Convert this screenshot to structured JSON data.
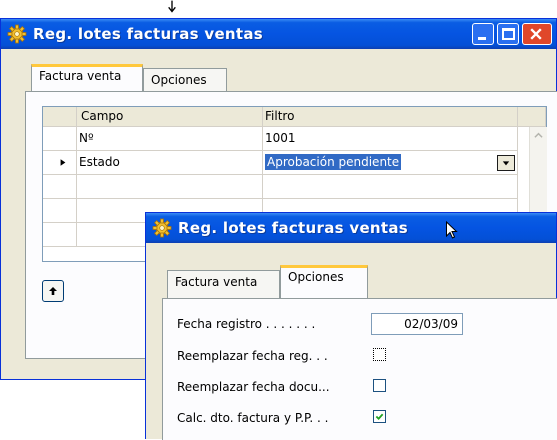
{
  "window1": {
    "title": "Reg. lotes facturas ventas",
    "tabs": [
      {
        "label": "Factura venta",
        "active": true
      },
      {
        "label": "Opciones",
        "active": false
      }
    ],
    "grid": {
      "columns": [
        "Campo",
        "Filtro"
      ],
      "rows": [
        {
          "campo": "Nº",
          "filtro": "1001"
        },
        {
          "campo": "Estado",
          "filtro": "Aprobación pendiente"
        },
        {
          "campo": "",
          "filtro": ""
        },
        {
          "campo": "",
          "filtro": ""
        },
        {
          "campo": "",
          "filtro": ""
        }
      ]
    }
  },
  "window2": {
    "title": "Reg. lotes facturas ventas",
    "tabs": [
      {
        "label": "Factura venta",
        "active": false
      },
      {
        "label": "Opciones",
        "active": true
      }
    ],
    "options": {
      "fecha_registro_label": "Fecha registro . . . . . . .",
      "fecha_registro_value": "02/03/09",
      "reemplazar_fecha_reg_label": "Reemplazar fecha reg. . .",
      "reemplazar_fecha_reg_checked": false,
      "reemplazar_fecha_docu_label": "Reemplazar fecha docu...",
      "reemplazar_fecha_docu_checked": false,
      "calc_dto_label": "Calc. dto. factura y P.P. . .",
      "calc_dto_checked": true
    }
  },
  "colors": {
    "titlebar": "#0554e2",
    "close_button": "#e0472a",
    "selection": "#316ac5",
    "tab_highlight": "#ffc83c",
    "face": "#ece9d8"
  },
  "icons": [
    "gear-icon",
    "minimize-icon",
    "maximize-icon",
    "close-icon",
    "row-pointer-icon",
    "dropdown-arrow-icon",
    "scroll-up-icon",
    "move-up-icon",
    "checkbox-icon",
    "checkmark-icon",
    "mouse-pointer-icon"
  ]
}
